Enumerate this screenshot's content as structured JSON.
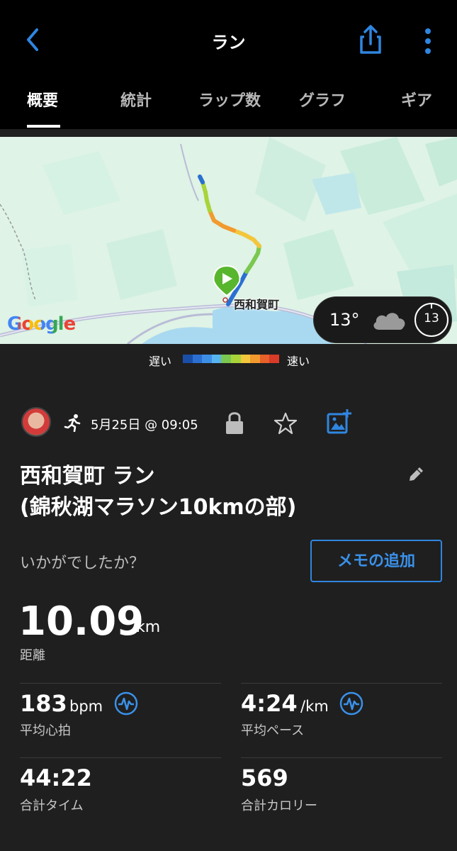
{
  "header": {
    "title": "ラン",
    "back_icon": "chevron-left-icon",
    "share_icon": "share-icon",
    "more_icon": "more-vertical-icon",
    "accent_color": "#2f86e0"
  },
  "tabs": [
    {
      "label": "概要",
      "active": true
    },
    {
      "label": "統計",
      "active": false
    },
    {
      "label": "ラップ数",
      "active": false
    },
    {
      "label": "グラフ",
      "active": false
    },
    {
      "label": "ギア",
      "active": false
    }
  ],
  "map": {
    "provider_logo": "Google",
    "place_label": "西和賀町",
    "weather": {
      "temperature": "13°",
      "condition_icon": "cloud-icon",
      "wind": "13"
    },
    "legend": {
      "slow_label": "遅い",
      "fast_label": "速い",
      "colors": [
        "#1a4fa8",
        "#2b6fd1",
        "#3d8fe6",
        "#58b4f0",
        "#7bc850",
        "#a8d43a",
        "#f3c63b",
        "#f29a2e",
        "#e8602a",
        "#d83b27"
      ]
    }
  },
  "activity": {
    "type_icon": "running-icon",
    "date": "5月25日 @ 09:05",
    "title_line1": "西和賀町 ラン",
    "title_line2": "(錦秋湖マラソン10kmの部)",
    "feedback_prompt": "いかがでしたか？",
    "memo_button": "メモの追加"
  },
  "stats": {
    "distance": {
      "value": "10.09",
      "unit": "km",
      "label": "距離"
    },
    "avg_hr": {
      "value": "183",
      "unit": "bpm",
      "label": "平均心拍"
    },
    "avg_pace": {
      "value": "4:24",
      "unit": "/km",
      "label": "平均ペース"
    },
    "total_time": {
      "value": "44:22",
      "label": "合計タイム"
    },
    "calories": {
      "value": "569",
      "label": "合計カロリー"
    }
  }
}
